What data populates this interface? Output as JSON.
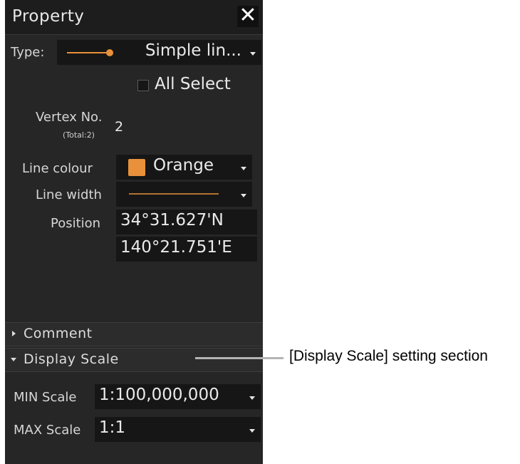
{
  "panel": {
    "title": "Property",
    "close_glyph": "✕",
    "type": {
      "label": "Type:",
      "value": "Simple lin...",
      "line_color": "#e8913a"
    },
    "all_select": {
      "label": "All Select",
      "checked": false
    },
    "vertex": {
      "label": "Vertex No.",
      "total": "(Total:2)",
      "value": "2"
    },
    "line_colour": {
      "label": "Line colour",
      "value": "Orange",
      "swatch": "#e8913a"
    },
    "line_width": {
      "label": "Line width",
      "line_color": "#e8913a"
    },
    "position": {
      "label": "Position",
      "lat": "34°31.627'N",
      "lon": "140°21.751'E"
    },
    "sections": {
      "comment": "Comment",
      "display_scale": "Display Scale"
    },
    "min_scale": {
      "label": "MIN Scale",
      "value": "1:100,000,000"
    },
    "max_scale": {
      "label": "MAX Scale",
      "value": "1:1"
    }
  },
  "annotation": {
    "text": "[Display Scale] setting section"
  },
  "colors": {
    "panel_bg": "#262626",
    "field_bg": "#161616",
    "accent": "#e8913a"
  }
}
